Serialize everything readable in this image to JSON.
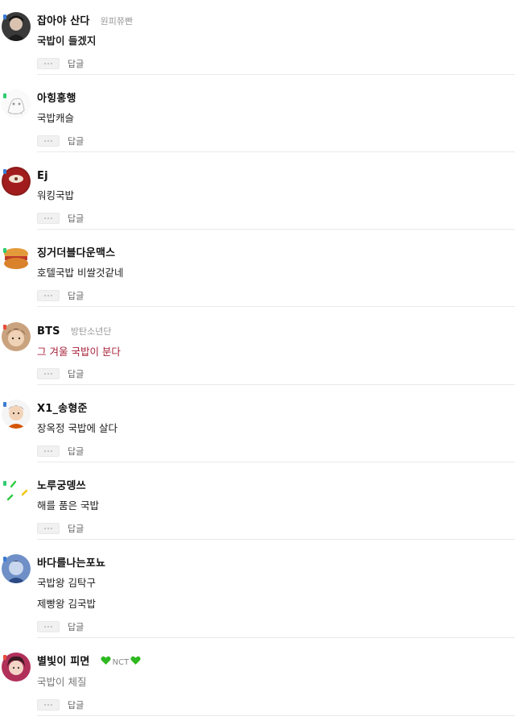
{
  "actions": {
    "more_label": "•••",
    "reply_label": "답글"
  },
  "comments": [
    {
      "nick": "잡아야 산다",
      "sub": "원피쮸빤",
      "lines": [
        "국밥이 들겠지"
      ]
    },
    {
      "nick": "아힝홍행",
      "sub": "",
      "lines": [
        "국밥캐슬"
      ]
    },
    {
      "nick": "Ej",
      "sub": "",
      "lines": [
        "워킹국밥"
      ]
    },
    {
      "nick": "징거더블다운맥스",
      "sub": "",
      "lines": [
        "호텔국밥 비쌀것같네"
      ]
    },
    {
      "nick": "BTS",
      "sub": "방탄소년단",
      "lines": [
        "그 겨울 국밥이 분다"
      ]
    },
    {
      "nick": "X1_송형준",
      "sub": "",
      "lines": [
        "장옥정 국밥에 살다"
      ]
    },
    {
      "nick": "노루궁뎅쓰",
      "sub": "",
      "lines": [
        "해를 품은 국밥"
      ]
    },
    {
      "nick": "바다를나는포뇨",
      "sub": "",
      "lines": [
        "국밥왕 김탁구",
        "제빵왕 김국밥"
      ]
    },
    {
      "nick": "별빛이 피면",
      "sub": "NCT",
      "lines": [
        "국밥이 체질"
      ]
    }
  ],
  "colors": {
    "highlight_text": "#a8233b",
    "heart": "#2fb81f",
    "level_green": "#2ecc71"
  }
}
